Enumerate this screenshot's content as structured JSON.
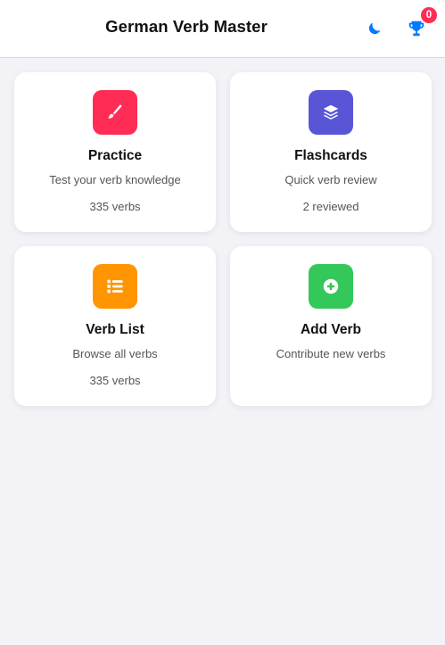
{
  "header": {
    "title": "German Verb Master",
    "theme_icon": "moon-icon",
    "trophy_icon": "trophy-icon",
    "trophy_badge": "0"
  },
  "colors": {
    "accent": "#007aff",
    "badge": "#ff2d55",
    "practice": "#ff2d55",
    "flashcards": "#5856d6",
    "verb_list": "#ff9500",
    "add_verb": "#34c759",
    "background": "#f2f2f7"
  },
  "cards": [
    {
      "title": "Practice",
      "description": "Test your verb knowledge",
      "stat": "335 verbs",
      "icon": "pen-icon"
    },
    {
      "title": "Flashcards",
      "description": "Quick verb review",
      "stat": "2 reviewed",
      "icon": "layers-icon"
    },
    {
      "title": "Verb List",
      "description": "Browse all verbs",
      "stat": "335 verbs",
      "icon": "list-icon"
    },
    {
      "title": "Add Verb",
      "description": "Contribute new verbs",
      "stat": "",
      "icon": "plus-circle-icon"
    }
  ]
}
